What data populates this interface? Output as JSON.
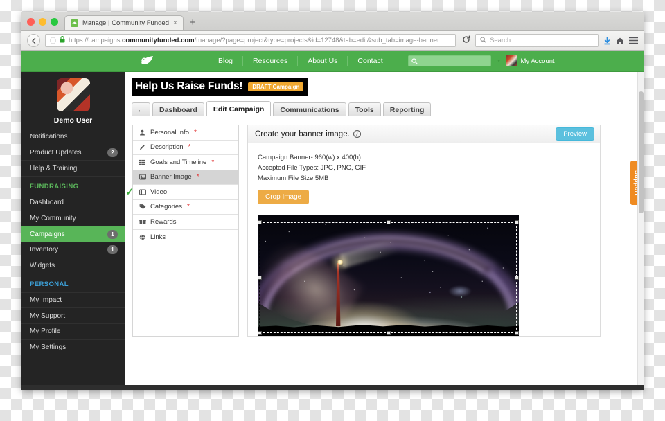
{
  "browser": {
    "tab": {
      "title": "Manage | Community Funded",
      "favicon_icon": "leaf-favicon",
      "close_icon": "×",
      "new_tab_icon": "+"
    },
    "toolbar": {
      "back_icon": "‹",
      "info_icon": "ⓘ",
      "lock_icon": "🔒",
      "url_scheme": "https://campaigns.",
      "url_domain": "communityfunded.com",
      "url_path": "/manage/?page=project&type=projects&id=12748&tab=edit&sub_tab=image-banner",
      "reload_icon": "⟳",
      "search_placeholder": "Search",
      "search_icon": "search-icon",
      "download_icon": "↓",
      "home_icon": "⌂",
      "menu_icon": "☰"
    }
  },
  "site_nav": {
    "logo_icon": "leaf-logo",
    "links": [
      "Blog",
      "Resources",
      "About Us",
      "Contact"
    ],
    "search_icon": "search-icon",
    "caret_icon": "chevron-down-icon",
    "account_label": "My Account"
  },
  "sidebar": {
    "user_name": "Demo User",
    "top_items": [
      {
        "label": "Notifications",
        "badge": ""
      },
      {
        "label": "Product Updates",
        "badge": "2"
      },
      {
        "label": "Help & Training",
        "badge": ""
      }
    ],
    "fundraising_heading": "FUNDRAISING",
    "fundraising_items": [
      {
        "label": "Dashboard",
        "badge": "",
        "active": false
      },
      {
        "label": "My Community",
        "badge": "",
        "active": false
      },
      {
        "label": "Campaigns",
        "badge": "1",
        "active": true
      },
      {
        "label": "Inventory",
        "badge": "1",
        "active": false
      },
      {
        "label": "Widgets",
        "badge": "",
        "active": false
      }
    ],
    "personal_heading": "PERSONAL",
    "personal_items": [
      {
        "label": "My Impact"
      },
      {
        "label": "My Support"
      },
      {
        "label": "My Profile"
      },
      {
        "label": "My Settings"
      }
    ]
  },
  "campaign": {
    "title": "Help Us Raise Funds!",
    "status_badge": "DRAFT Campaign",
    "back_icon": "←",
    "tabs": [
      {
        "label": "Dashboard",
        "active": false
      },
      {
        "label": "Edit Campaign",
        "active": true
      },
      {
        "label": "Communications",
        "active": false
      },
      {
        "label": "Tools",
        "active": false
      },
      {
        "label": "Reporting",
        "active": false
      }
    ]
  },
  "edit_menu": [
    {
      "label": "Personal Info",
      "required": "*",
      "icon": "user-icon",
      "glyph": "♟",
      "active": false,
      "complete": false
    },
    {
      "label": "Description",
      "required": "*",
      "icon": "pencil-icon",
      "glyph": "✎",
      "active": false,
      "complete": false
    },
    {
      "label": "Goals and Timeline",
      "required": "*",
      "icon": "list-icon",
      "glyph": "≡",
      "active": false,
      "complete": false
    },
    {
      "label": "Banner Image",
      "required": "*",
      "icon": "image-icon",
      "glyph": "▣",
      "active": true,
      "complete": false
    },
    {
      "label": "Video",
      "required": "",
      "icon": "video-icon",
      "glyph": "▤",
      "active": false,
      "complete": true
    },
    {
      "label": "Categories",
      "required": "*",
      "icon": "tag-icon",
      "glyph": "⚑",
      "active": false,
      "complete": false
    },
    {
      "label": "Rewards",
      "required": "",
      "icon": "gift-icon",
      "glyph": "☗",
      "active": false,
      "complete": false
    },
    {
      "label": "Links",
      "required": "",
      "icon": "globe-icon",
      "glyph": "⊕",
      "active": false,
      "complete": false
    }
  ],
  "check_glyph": "✓",
  "panel": {
    "title": "Create your banner image.",
    "info_icon": "i",
    "preview_label": "Preview",
    "spec_dimensions": "Campaign Banner- 960(w) x 400(h)",
    "spec_filetypes": "Accepted File Types: JPG, PNG, GIF",
    "spec_filesize": "Maximum File Size 5MB",
    "crop_button_label": "Crop Image",
    "banner_alt": "Milky Way arch over red lighthouse at night"
  },
  "support": {
    "label": "Support"
  }
}
